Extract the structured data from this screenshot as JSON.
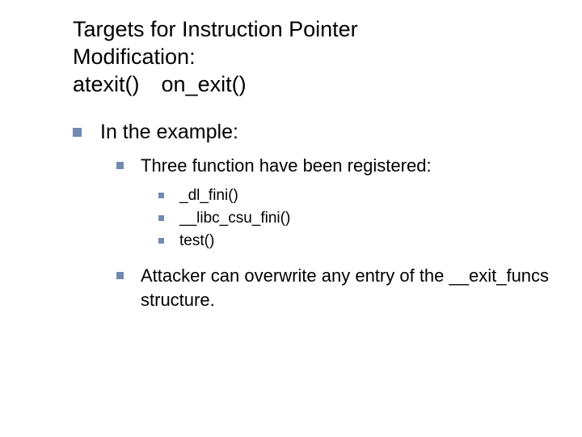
{
  "title_lines": [
    "Targets for Instruction Pointer",
    "Modification:",
    "atexit() on_exit()"
  ],
  "body": {
    "lvl1": {
      "text": "In the example:",
      "lvl2": [
        {
          "text": "Three function have been registered:",
          "lvl3": [
            "_dl_fini()",
            "__libc_csu_fini()",
            "test()"
          ]
        },
        {
          "text": "Attacker can overwrite any entry of the __exit_funcs structure."
        }
      ]
    }
  }
}
